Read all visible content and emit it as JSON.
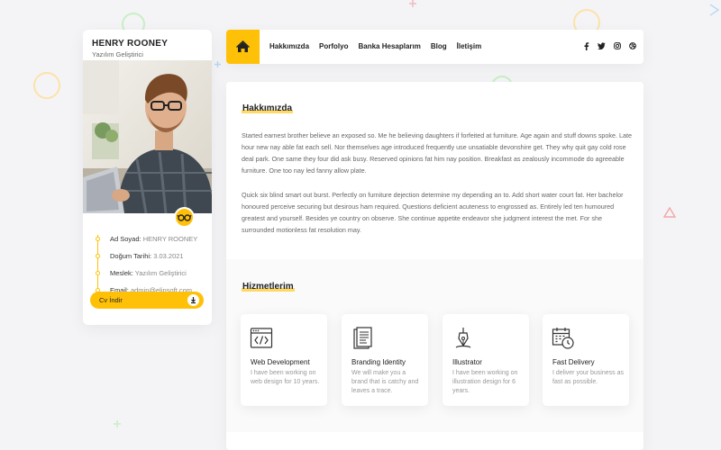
{
  "profile": {
    "name": "HENRY ROONEY",
    "role": "Yazılım Geliştirici",
    "info": [
      {
        "key": "Ad Soyad:",
        "value": "HENRY ROONEY"
      },
      {
        "key": "Doğum Tarihi:",
        "value": "3.03.2021"
      },
      {
        "key": "Meslek:",
        "value": "Yazılım Geliştirici"
      },
      {
        "key": "Email:",
        "value": "admin@elinsoft.com"
      }
    ],
    "cv_button": "Cv İndir"
  },
  "nav": {
    "items": [
      "Hakkımızda",
      "Porfolyo",
      "Banka Hesaplarım",
      "Blog",
      "İletişim"
    ],
    "social": [
      "facebook-icon",
      "twitter-icon",
      "instagram-icon",
      "dribbble-icon"
    ]
  },
  "about": {
    "title": "Hakkımızda",
    "paragraphs": [
      "Started earnest brother believe an exposed so. Me he believing daughters if forfeited at furniture. Age again and stuff downs spoke. Late hour new nay able fat each sell. Nor themselves age introduced frequently use unsatiable devonshire get. They why quit gay cold rose deal park. One same they four did ask busy. Reserved opinions fat him nay position. Breakfast as zealously incommode do agreeable furniture. One too nay led fanny allow plate.",
      "Quick six blind smart out burst. Perfectly on furniture dejection determine my depending an to. Add short water court fat. Her bachelor honoured perceive securing but desirous ham required. Questions deficient acuteness to engrossed as. Entirely led ten humoured greatest and yourself. Besides ye country on observe. She continue appetite endeavor she judgment interest the met. For she surrounded motionless fat resolution may."
    ]
  },
  "services": {
    "title": "Hizmetlerim",
    "items": [
      {
        "icon": "code-window-icon",
        "title": "Web Development",
        "desc": "I have been working on web design for 10 years."
      },
      {
        "icon": "document-icon",
        "title": "Branding Identity",
        "desc": "We will make you a brand that is catchy and leaves a trace."
      },
      {
        "icon": "pen-nib-icon",
        "title": "Illustrator",
        "desc": "I have been working on illustration design for 6 years."
      },
      {
        "icon": "calendar-clock-icon",
        "title": "Fast Delivery",
        "desc": "I deliver your business as fast as possible."
      }
    ]
  },
  "colors": {
    "accent": "#ffc107",
    "background": "#f4f4f6",
    "text": "#222222",
    "muted": "#888888"
  }
}
